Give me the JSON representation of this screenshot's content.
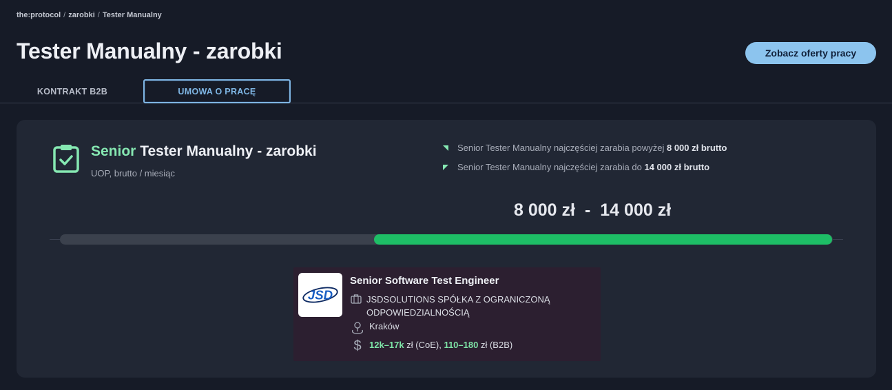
{
  "breadcrumb": {
    "root": "the:protocol",
    "sep1": "/",
    "section": "zarobki",
    "sep2": "/",
    "current": "Tester Manualny"
  },
  "header": {
    "title": "Tester Manualny - zarobki",
    "cta_label": "Zobacz oferty pracy"
  },
  "tabs": [
    {
      "label": "KONTRAKT B2B",
      "active": false
    },
    {
      "label": "UMOWA O PRACĘ",
      "active": true
    }
  ],
  "card": {
    "icon": "clipboard-check-icon",
    "title_level": "Senior",
    "title_rest": "Tester Manualny - zarobki",
    "subtitle": "UOP, brutto / miesiąc",
    "stats": [
      {
        "text": "Senior Tester Manualny najczęściej zarabia powyżej",
        "value": "8 000 zł brutto"
      },
      {
        "text": "Senior Tester Manualny najczęściej zarabia do",
        "value": "14 000 zł brutto"
      }
    ],
    "range": {
      "low": "8 000 zł",
      "dash": "-",
      "high": "14 000 zł"
    },
    "bar": {
      "fill_start": 0.406,
      "fill_end": 0.999
    },
    "colors": {
      "accent": "#1ebe66",
      "level": "#86e8b2",
      "cta": "#8cc4ee"
    }
  },
  "offer": {
    "logo_text": "JSD",
    "title": "Senior Software Test Engineer",
    "company": "JSDSOLUTIONS SPÓŁKA Z OGRANICZONĄ ODPOWIEDZIALNOŚCIĄ",
    "city": "Kraków",
    "salary": {
      "coe_value": "12k–17k",
      "coe_unit": "zł (CoE),",
      "b2b_value": "110–180",
      "b2b_unit": "zł (B2B)"
    }
  }
}
